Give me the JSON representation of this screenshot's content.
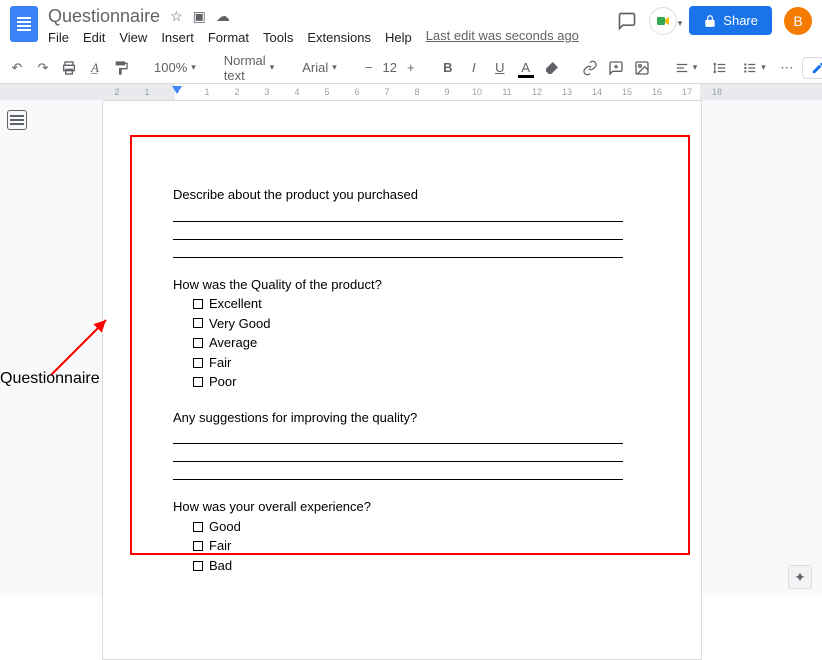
{
  "header": {
    "doc_title": "Questionnaire",
    "last_edit": "Last edit was seconds ago",
    "avatar_initial": "B",
    "share_label": "Share"
  },
  "menus": [
    "File",
    "Edit",
    "View",
    "Insert",
    "Format",
    "Tools",
    "Extensions",
    "Help"
  ],
  "toolbar": {
    "zoom": "100%",
    "style": "Normal text",
    "font": "Arial",
    "size": "12"
  },
  "ruler": {
    "numbers": [
      "2",
      "1",
      "",
      "1",
      "2",
      "3",
      "4",
      "5",
      "6",
      "7",
      "8",
      "9",
      "10",
      "11",
      "12",
      "13",
      "14",
      "15",
      "16",
      "17",
      "18"
    ]
  },
  "annotation": {
    "label": "Questionnaire"
  },
  "doc": {
    "q1": {
      "prompt": "Describe about the product you purchased",
      "blank_lines": 3
    },
    "q2": {
      "prompt": "How was the Quality of the product?",
      "options": [
        "Excellent",
        "Very Good",
        "Average",
        "Fair",
        "Poor"
      ]
    },
    "q3": {
      "prompt": "Any suggestions for improving the quality?",
      "blank_lines": 3
    },
    "q4": {
      "prompt": "How was your overall experience?",
      "options": [
        "Good",
        "Fair",
        "Bad"
      ]
    }
  }
}
